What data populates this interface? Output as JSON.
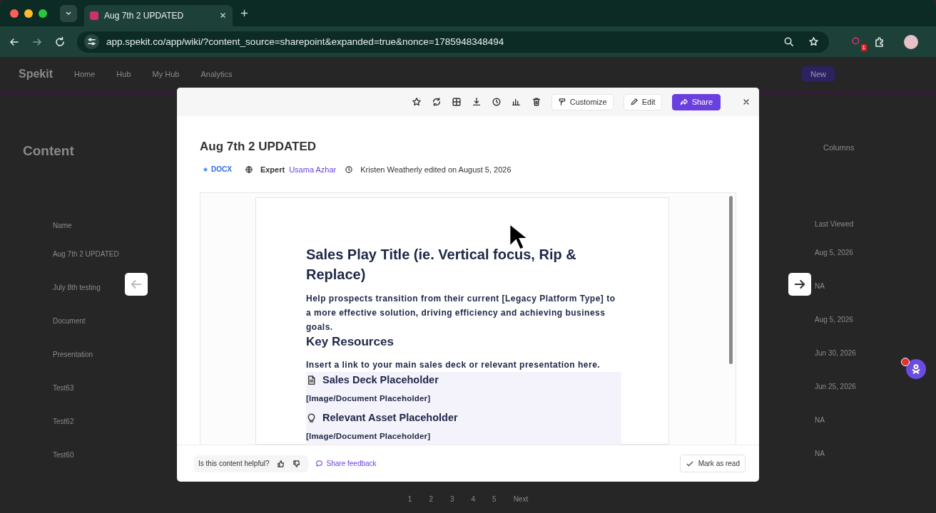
{
  "browser": {
    "tab_title": "Aug 7th 2 UPDATED",
    "url": "app.spekit.co/app/wiki/?content_source=sharepoint&expanded=true&nonce=1785948348494",
    "extension_badge": "1"
  },
  "app": {
    "logo": "Spekit",
    "nav": [
      "Home",
      "Hub",
      "My Hub",
      "Analytics"
    ],
    "new_button": "New",
    "page_title": "Content",
    "columns_button": "Columns",
    "column_name": "Name",
    "column_last_viewed": "Last Viewed",
    "rows": [
      {
        "name": "Aug 7th 2 UPDATED",
        "last_viewed": "Aug 5, 2026"
      },
      {
        "name": "July 8th testing",
        "last_viewed": "NA"
      },
      {
        "name": "Document",
        "last_viewed": "Aug 5, 2026"
      },
      {
        "name": "Presentation",
        "last_viewed": "Jun 30, 2026"
      },
      {
        "name": "Test63",
        "last_viewed": "Jun 25, 2026"
      },
      {
        "name": "Test62",
        "last_viewed": "NA"
      },
      {
        "name": "Test60",
        "last_viewed": "NA"
      }
    ],
    "pages": [
      "1",
      "2",
      "3",
      "4",
      "5"
    ],
    "next": "Next"
  },
  "modal": {
    "buttons": [
      {
        "kind": "customize",
        "label": "Customize"
      },
      {
        "kind": "edit",
        "label": "Edit"
      },
      {
        "kind": "share",
        "label": "Share"
      }
    ],
    "title": "Aug 7th 2 UPDATED",
    "file_type": "DOCX",
    "expert_label": "Expert",
    "expert_name": "Usama Azhar",
    "edited": "Kristen Weatherly edited on August 5, 2026",
    "document": {
      "heading": "Sales Play Title (ie. Vertical focus, Rip & Replace)",
      "intro": "Help prospects transition from their current [Legacy Platform Type] to a more effective solution, driving efficiency and achieving business goals.",
      "section": "Key Resources",
      "instruction": "Insert a link to your main sales deck or relevant presentation here.",
      "resources": [
        {
          "kind": "document",
          "title": "Sales Deck Placeholder",
          "caption": "[Image/Document Placeholder]"
        },
        {
          "kind": "bulb",
          "title": "Relevant Asset Placeholder",
          "caption": "[Image/Document Placeholder]"
        }
      ]
    },
    "helpful_question": "Is this content helpful?",
    "feedback_link": "Share feedback",
    "mark_read": "Mark as read"
  }
}
